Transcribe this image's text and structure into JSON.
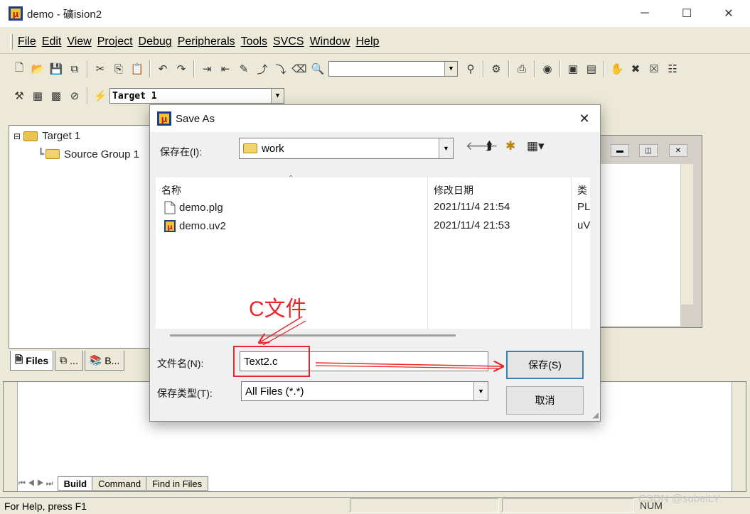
{
  "app": {
    "title": "demo  - 礦ision2",
    "window_controls": {
      "minimize": "─",
      "maximize": "☐",
      "close": "✕"
    }
  },
  "menu": [
    "File",
    "Edit",
    "View",
    "Project",
    "Debug",
    "Peripherals",
    "Tools",
    "SVCS",
    "Window",
    "Help"
  ],
  "toolbar2": {
    "target_value": "Target 1"
  },
  "tree": {
    "root": "Target 1",
    "group": "Source Group 1"
  },
  "left_tabs": [
    "Files",
    "...",
    "B..."
  ],
  "output_tabs": [
    "Build",
    "Command",
    "Find in Files"
  ],
  "status": {
    "help": "For Help, press F1",
    "num": "NUM"
  },
  "dialog": {
    "title": "Save As",
    "save_in_label": "保存在(I):",
    "save_in_value": "work",
    "columns": {
      "name": "名称",
      "date": "修改日期",
      "type": "类"
    },
    "files": [
      {
        "name": "demo.plg",
        "date": "2021/11/4 21:54",
        "type": "PL"
      },
      {
        "name": "demo.uv2",
        "date": "2021/11/4 21:53",
        "type": "uV"
      }
    ],
    "filename_label": "文件名(N):",
    "filename_value": "Text2.c",
    "filetype_label": "保存类型(T):",
    "filetype_value": "All Files (*.*)",
    "save_button": "保存(S)",
    "cancel_button": "取消"
  },
  "annotation": {
    "text": "C文件",
    "color": "#e8262b"
  },
  "watermark": "CSDN @subeiLY"
}
